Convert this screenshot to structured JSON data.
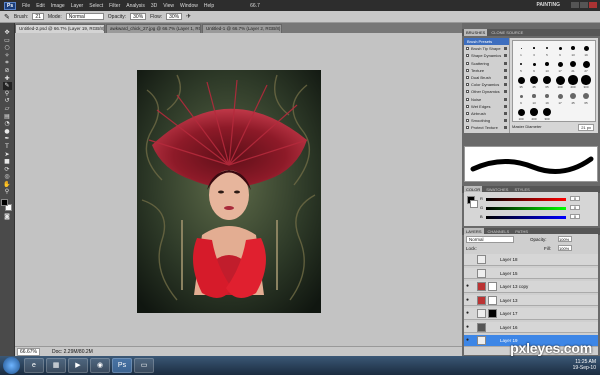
{
  "menubar": {
    "items": [
      "File",
      "Edit",
      "Image",
      "Layer",
      "Select",
      "Filter",
      "Analysis",
      "3D",
      "View",
      "Window",
      "Help"
    ],
    "zoom": "66.7",
    "workspace": "PAINTING"
  },
  "options": {
    "brush_label": "Brush:",
    "brush_size": "21",
    "mode_label": "Mode:",
    "mode_value": "Normal",
    "opacity_label": "Opacity:",
    "opacity_value": "30%",
    "flow_label": "Flow:",
    "flow_value": "30%"
  },
  "tabs": [
    {
      "label": "Untitled-2.psd @ 66.7% (Layer 19, RGB/8) *"
    },
    {
      "label": "awkward_chick_27.jpg @ 66.7% (Layer 1, RGB/8)"
    },
    {
      "label": "Untitled-1 @ 66.7% (Layer 2, RGB/8)"
    }
  ],
  "status": {
    "zoom": "66.67%",
    "doc": "Doc: 2.29M/80.2M"
  },
  "brushes": {
    "tabs": [
      "BRUSHES",
      "CLONE SOURCE"
    ],
    "items": [
      "Brush Presets",
      "Brush Tip Shape",
      "Shape Dynamics",
      "Scattering",
      "Texture",
      "Dual Brush",
      "Color Dynamics",
      "Other Dynamics",
      "Noise",
      "Wet Edges",
      "Airbrush",
      "Smoothing",
      "Protect Texture"
    ],
    "master_label": "Master Diameter",
    "master_value": "21 px",
    "sizes": [
      "1",
      "3",
      "5",
      "9",
      "13",
      "19",
      "5",
      "9",
      "13",
      "17",
      "21",
      "27",
      "35",
      "45",
      "65",
      "100",
      "200",
      "300",
      "9",
      "13",
      "19",
      "17",
      "45",
      "65",
      "100",
      "200",
      "300"
    ]
  },
  "color": {
    "tabs": [
      "COLOR",
      "SWATCHES",
      "STYLES"
    ],
    "r": "0",
    "g": "0",
    "b": "0",
    "R": "R",
    "G": "G",
    "B": "B"
  },
  "layers": {
    "tabs": [
      "LAYERS",
      "CHANNELS",
      "PATHS"
    ],
    "blend": "Normal",
    "opacity_label": "Opacity:",
    "opacity": "100%",
    "lock_label": "Lock:",
    "fill_label": "Fill:",
    "fill": "100%",
    "rows": [
      "Layer 18",
      "Layer 15",
      "Layer 13 copy",
      "Layer 13",
      "Layer 17",
      "Layer 16",
      "Layer 19"
    ]
  },
  "taskbar": {
    "time": "11:25 AM",
    "date": "19-Sep-10"
  },
  "watermark": "pxleyes.com"
}
